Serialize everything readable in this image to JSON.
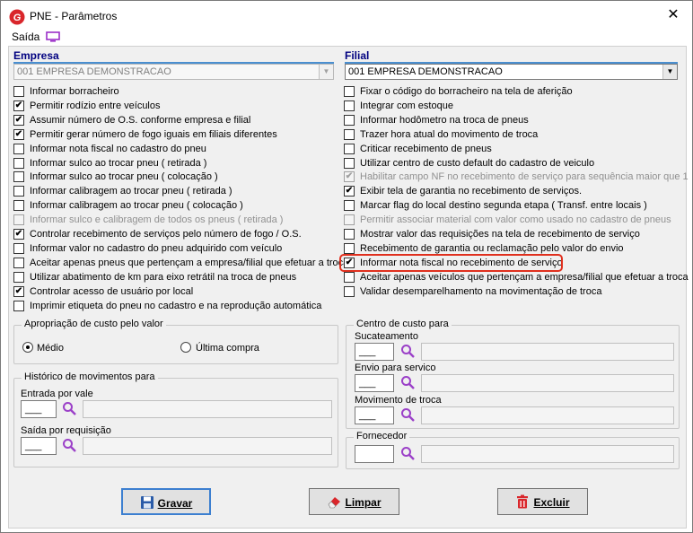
{
  "window": {
    "title": "PNE - Parâmetros",
    "close_label": "✕"
  },
  "menubar": {
    "saida_label": "Saída"
  },
  "empresa": {
    "header": "Empresa",
    "value": "001 EMPRESA DEMONSTRACAO"
  },
  "filial": {
    "header": "Filial",
    "value": "001 EMPRESA DEMONSTRACAO"
  },
  "left_checks": [
    {
      "label": "Informar borracheiro",
      "checked": false,
      "disabled": false
    },
    {
      "label": "Permitir rodízio entre veículos",
      "checked": true,
      "disabled": false
    },
    {
      "label": "Assumir número de O.S. conforme empresa e filial",
      "checked": true,
      "disabled": false
    },
    {
      "label": "Permitir gerar número de fogo iguais em filiais diferentes",
      "checked": true,
      "disabled": false
    },
    {
      "label": "Informar nota fiscal no cadastro do pneu",
      "checked": false,
      "disabled": false
    },
    {
      "label": "Informar sulco ao trocar pneu ( retirada )",
      "checked": false,
      "disabled": false
    },
    {
      "label": "Informar sulco ao trocar pneu ( colocação )",
      "checked": false,
      "disabled": false
    },
    {
      "label": "Informar calibragem ao trocar pneu ( retirada )",
      "checked": false,
      "disabled": false
    },
    {
      "label": "Informar calibragem ao trocar pneu ( colocação )",
      "checked": false,
      "disabled": false
    },
    {
      "label": "Informar sulco e calibragem de todos os pneus ( retirada )",
      "checked": false,
      "disabled": true
    },
    {
      "label": "Controlar recebimento de serviços pelo número de fogo / O.S.",
      "checked": true,
      "disabled": false
    },
    {
      "label": "Informar valor no cadastro do pneu adquirido com veículo",
      "checked": false,
      "disabled": false
    },
    {
      "label": "Aceitar apenas pneus que pertençam a empresa/filial que efetuar a troca",
      "checked": false,
      "disabled": false
    },
    {
      "label": "Utilizar abatimento de km para eixo retrátil na troca de pneus",
      "checked": false,
      "disabled": false
    },
    {
      "label": "Controlar acesso de usuário por local",
      "checked": true,
      "disabled": false
    },
    {
      "label": "Imprimir etiqueta do pneu no cadastro e na reprodução automática",
      "checked": false,
      "disabled": false
    }
  ],
  "right_checks": [
    {
      "label": "Fixar o código do borracheiro na tela de aferição",
      "checked": false,
      "disabled": false
    },
    {
      "label": "Integrar com estoque",
      "checked": false,
      "disabled": false
    },
    {
      "label": "Informar hodômetro na troca de pneus",
      "checked": false,
      "disabled": false
    },
    {
      "label": "Trazer hora atual do movimento de troca",
      "checked": false,
      "disabled": false
    },
    {
      "label": "Criticar recebimento de pneus",
      "checked": false,
      "disabled": false
    },
    {
      "label": "Utilizar centro de custo default do cadastro de veiculo",
      "checked": false,
      "disabled": false
    },
    {
      "label": "Habilitar campo NF no recebimento de serviço para sequência maior que 1",
      "checked": true,
      "disabled": true
    },
    {
      "label": "Exibir tela de garantia no recebimento de serviços.",
      "checked": true,
      "disabled": false
    },
    {
      "label": "Marcar flag do local destino segunda etapa ( Transf. entre locais )",
      "checked": false,
      "disabled": false
    },
    {
      "label": "Permitir associar material com valor como usado no cadastro de pneus",
      "checked": false,
      "disabled": true
    },
    {
      "label": "Mostrar valor das requisições na tela de recebimento de serviço",
      "checked": false,
      "disabled": false
    },
    {
      "label": "Recebimento de garantia ou reclamação pelo valor do envio",
      "checked": false,
      "disabled": false
    },
    {
      "label": "Informar nota fiscal no recebimento de serviço",
      "checked": true,
      "disabled": false
    },
    {
      "label": "Aceitar apenas veículos que pertençam a empresa/filial que efetuar a troca",
      "checked": false,
      "disabled": false
    },
    {
      "label": "Validar desemparelhamento na movimentação de troca",
      "checked": false,
      "disabled": false
    }
  ],
  "apropriacao": {
    "title": "Apropriação de custo pelo valor",
    "option1": "Médio",
    "option2": "Última compra",
    "selected": "Médio"
  },
  "historico": {
    "title": "Histórico de movimentos para",
    "entrada_label": "Entrada por vale",
    "saida_label": "Saída por requisição",
    "entrada_code": "___",
    "saida_code": "___"
  },
  "centro_custo": {
    "title": "Centro de custo para",
    "sucateamento_label": "Sucateamento",
    "envio_label": "Envio para servico",
    "movimento_label": "Movimento de troca",
    "sucateamento_code": "___",
    "envio_code": "___",
    "movimento_code": "___"
  },
  "fornecedor": {
    "title": "Fornecedor"
  },
  "buttons": {
    "gravar": "Gravar",
    "limpar": "Limpar",
    "excluir": "Excluir"
  },
  "colors": {
    "accent": "#3c7fd0",
    "highlight": "#e0301e",
    "search_icon": "#9b40c8"
  }
}
